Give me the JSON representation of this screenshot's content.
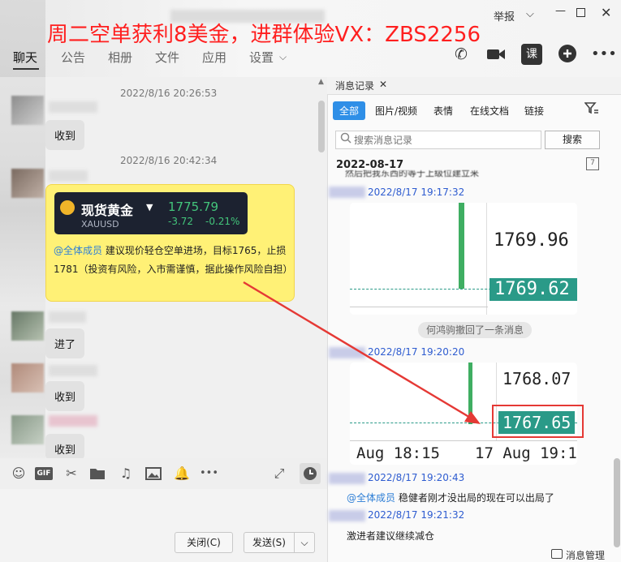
{
  "banner_text": "周二空单获利8美金，进群体验VX：ZBS2256",
  "window": {
    "report": "举报"
  },
  "nav": {
    "tabs": [
      "聊天",
      "公告",
      "相册",
      "文件",
      "应用",
      "设置"
    ]
  },
  "top_icons": [
    "phone-icon",
    "video-icon",
    "class-icon",
    "add-circle-icon",
    "more-icon"
  ],
  "chat": {
    "messages": [
      {
        "time": "2022/8/16 20:26:53",
        "text": "收到"
      },
      {
        "time": "2022/8/16 20:42:34"
      },
      {
        "text": "进了"
      },
      {
        "text": "收到"
      },
      {
        "text": "收到"
      }
    ],
    "gold_card": {
      "name": "现货黄金",
      "symbol": "XAUUSD",
      "price": "1775.79",
      "change": "-3.72",
      "change_pct": "-0.21%"
    },
    "broadcast": {
      "mention": "@全体成员",
      "text": "建议现价轻仓空单进场，目标1765，止损1781（投资有风险，入市需谨慎，据此操作风险自担）"
    }
  },
  "toolbar": {
    "icons": [
      "emoji-icon",
      "gif-icon",
      "scissors-icon",
      "folder-icon",
      "music-icon",
      "image-icon",
      "bell-icon",
      "more-icon",
      "expand-icon",
      "history-icon"
    ]
  },
  "buttons": {
    "close": "关闭(C)",
    "send": "发送(S)"
  },
  "history": {
    "title": "消息记录",
    "filters": [
      "全部",
      "图片/视频",
      "表情",
      "在线文档",
      "链接"
    ],
    "search_placeholder": "搜索消息记录",
    "search_button": "搜索",
    "date": "2022-08-17",
    "partial_text": "然后把我东西的等于上级位建立来",
    "items": [
      {
        "time": "2022/8/17 19:17:32",
        "chart": {
          "price_top": "1769.96",
          "price_box": "1769.62"
        }
      },
      {
        "notice": "何鸿驹撤回了一条消息"
      },
      {
        "time": "2022/8/17 19:20:20",
        "chart": {
          "price_top": "1768.07",
          "price_box": "1767.65",
          "x_labels": [
            "Aug 18:15",
            "17 Aug 19:1"
          ]
        }
      },
      {
        "time": "2022/8/17 19:20:43",
        "mention": "@全体成员",
        "text": "稳健者刚才没出局的现在可以出局了"
      },
      {
        "time": "2022/8/17 19:21:32",
        "text": "激进者建议继续减仓"
      }
    ],
    "manage": "消息管理"
  },
  "colors": {
    "accent": "#2f8fe7",
    "banner": "#ff1f1f",
    "highlight": "#e53935",
    "green": "#3fae62",
    "teal": "#2a9a88",
    "bubble": "#fff176"
  }
}
